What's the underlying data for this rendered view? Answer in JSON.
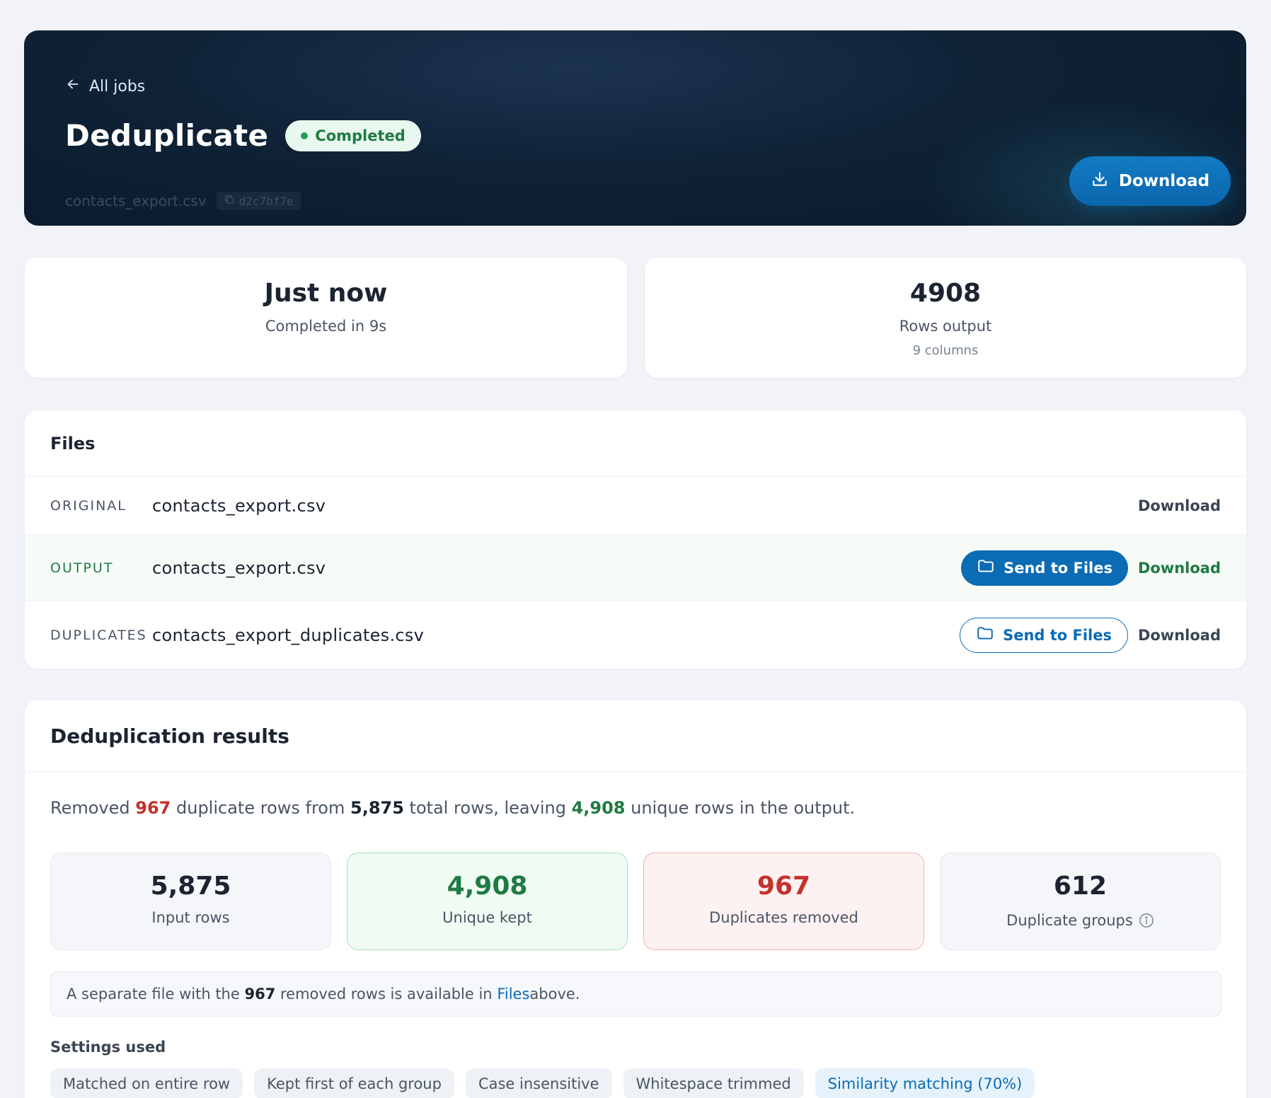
{
  "header": {
    "back_label": "All jobs",
    "title": "Deduplicate",
    "status": "Completed",
    "filename": "contacts_export.csv",
    "job_id": "d2c7bf7e",
    "download_label": "Download"
  },
  "stats": {
    "time": {
      "main": "Just now",
      "sub": "Completed in 9s"
    },
    "rows": {
      "main": "4908",
      "sub": "Rows output",
      "sub2": "9 columns"
    }
  },
  "files": {
    "title": "Files",
    "rows": [
      {
        "label": "ORIGINAL",
        "name": "contacts_export.csv",
        "download": "Download"
      },
      {
        "label": "OUTPUT",
        "name": "contacts_export.csv",
        "send": "Send to Files",
        "download": "Download"
      },
      {
        "label": "DUPLICATES",
        "name": "contacts_export_duplicates.csv",
        "send": "Send to Files",
        "download": "Download"
      }
    ]
  },
  "results": {
    "title": "Deduplication results",
    "summary": {
      "p1": "Removed ",
      "removed": "967",
      "p2": " duplicate rows from ",
      "total": "5,875",
      "p3": " total rows, leaving ",
      "unique": "4,908",
      "p4": " unique rows in the output."
    },
    "cards": [
      {
        "value": "5,875",
        "label": "Input rows"
      },
      {
        "value": "4,908",
        "label": "Unique kept"
      },
      {
        "value": "967",
        "label": "Duplicates removed"
      },
      {
        "value": "612",
        "label": "Duplicate groups"
      }
    ],
    "note": {
      "p1": "A separate file with the ",
      "count": "967",
      "p2": " removed rows is available in ",
      "link": "Files",
      "p3": " above."
    },
    "settings_title": "Settings used",
    "settings": [
      "Matched on entire row",
      "Kept first of each group",
      "Case insensitive",
      "Whitespace trimmed",
      "Similarity matching (70%)"
    ]
  },
  "colors": {
    "accent": "#0b6bb5",
    "success": "#1f7a43",
    "danger": "#c4322d",
    "hero_bg": "#0f2236"
  }
}
